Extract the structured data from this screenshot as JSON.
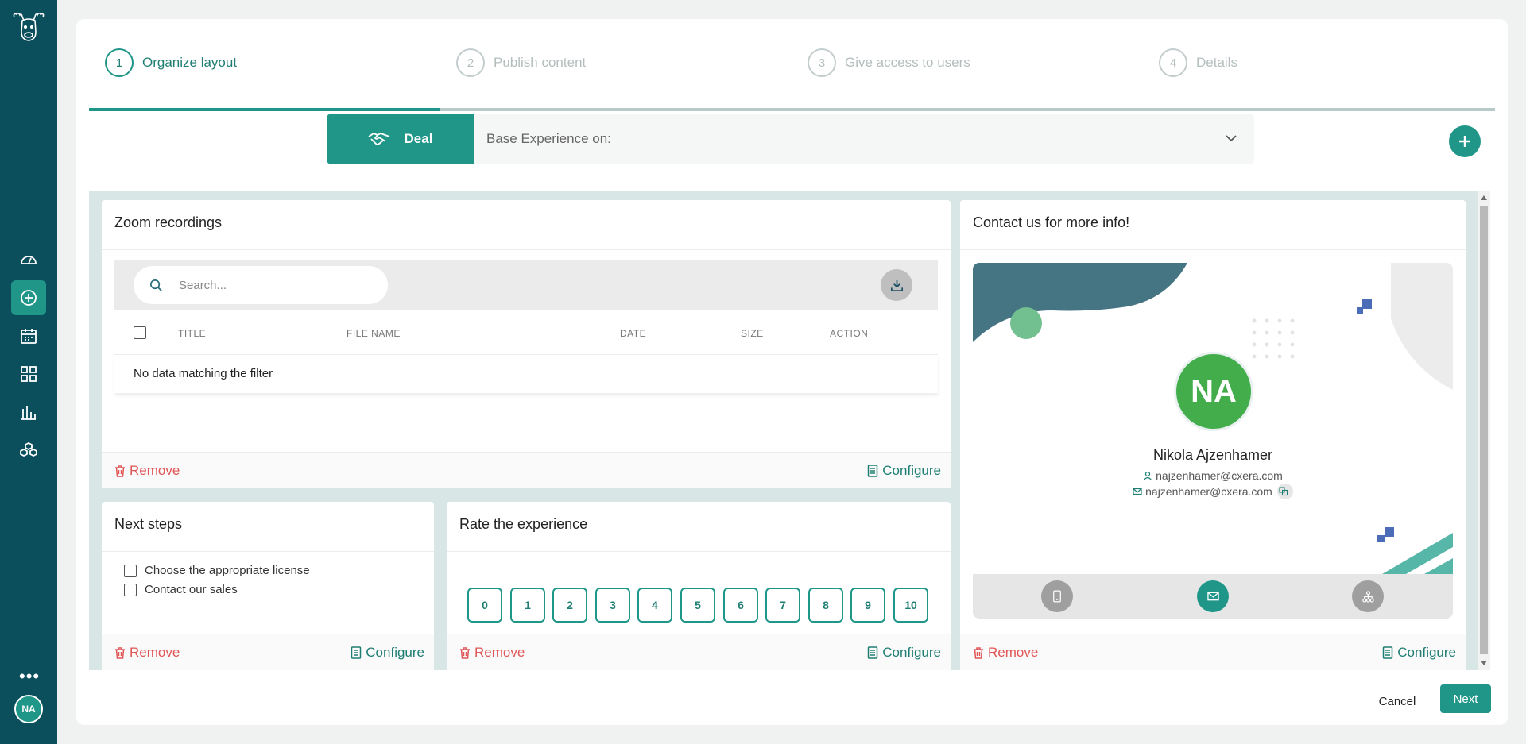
{
  "user": {
    "initials": "NA"
  },
  "steps": [
    {
      "num": "1",
      "label": "Organize layout"
    },
    {
      "num": "2",
      "label": "Publish content"
    },
    {
      "num": "3",
      "label": "Give access to users"
    },
    {
      "num": "4",
      "label": "Details"
    }
  ],
  "dealbar": {
    "deal_label": "Deal",
    "base_label": "Base Experience on:"
  },
  "zoom": {
    "title": "Zoom recordings",
    "search_placeholder": "Search...",
    "columns": [
      "TITLE",
      "FILE NAME",
      "DATE",
      "SIZE",
      "ACTION"
    ],
    "empty": "No data matching the filter"
  },
  "next_steps": {
    "title": "Next steps",
    "items": [
      "Choose the appropriate license",
      "Contact our sales"
    ]
  },
  "rate": {
    "title": "Rate the experience",
    "options": [
      "0",
      "1",
      "2",
      "3",
      "4",
      "5",
      "6",
      "7",
      "8",
      "9",
      "10"
    ]
  },
  "contact": {
    "title": "Contact us for more info!",
    "initials": "NA",
    "name": "Nikola Ajzenhamer",
    "username": "najzenhamer@cxera.com",
    "email": "najzenhamer@cxera.com"
  },
  "widget_actions": {
    "remove": "Remove",
    "configure": "Configure"
  },
  "footer": {
    "cancel": "Cancel",
    "next": "Next"
  },
  "colors": {
    "sidebar": "#0b4e5c",
    "accent": "#1f9688",
    "danger": "#e05656",
    "avatar": "#42ad4a"
  }
}
